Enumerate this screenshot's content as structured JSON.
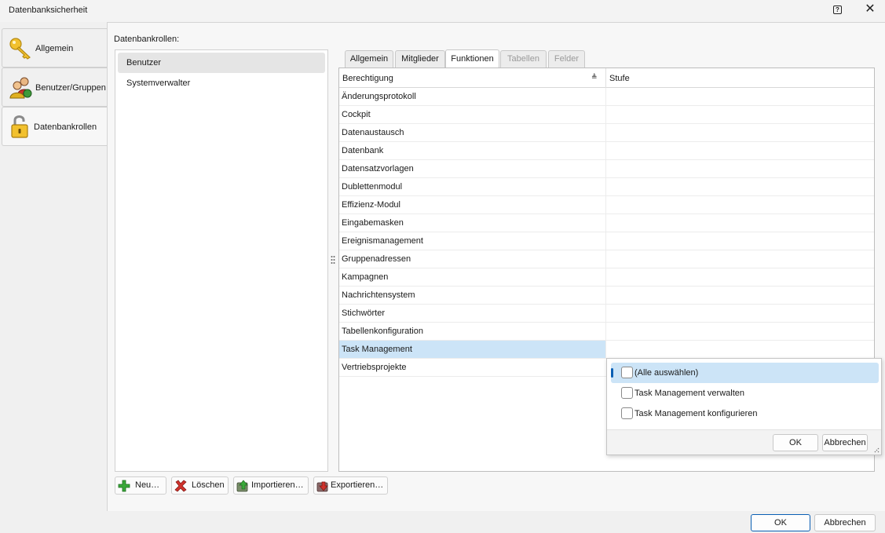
{
  "window": {
    "title": "Datenbanksicherheit",
    "help_glyph": "?",
    "close_glyph": "✕"
  },
  "nav": {
    "items": [
      {
        "label": "Allgemein",
        "icon": "key-icon"
      },
      {
        "label": "Benutzer/Gruppen",
        "icon": "users-icon"
      },
      {
        "label": "Datenbankrollen",
        "icon": "unlocked-padlock-icon",
        "active": true
      }
    ]
  },
  "roles": {
    "label": "Datenbankrollen:",
    "items": [
      "Benutzer",
      "Systemverwalter"
    ],
    "selected": "Benutzer"
  },
  "tabs": [
    {
      "label": "Allgemein",
      "state": "normal"
    },
    {
      "label": "Mitglieder",
      "state": "normal"
    },
    {
      "label": "Funktionen",
      "state": "active"
    },
    {
      "label": "Tabellen",
      "state": "disabled"
    },
    {
      "label": "Felder",
      "state": "disabled"
    }
  ],
  "grid": {
    "columns": [
      "Berechtigung",
      "Stufe"
    ],
    "sort_glyph": "≜",
    "rows": [
      "Änderungsprotokoll",
      "Cockpit",
      "Datenaustausch",
      "Datenbank",
      "Datensatzvorlagen",
      "Dublettenmodul",
      "Effizienz-Modul",
      "Eingabemasken",
      "Ereignismanagement",
      "Gruppenadressen",
      "Kampagnen",
      "Nachrichtensystem",
      "Stichwörter",
      "Tabellenkonfiguration",
      "Task Management",
      "Vertriebsprojekte"
    ],
    "selected_row": "Task Management"
  },
  "popup": {
    "options": [
      {
        "label": "(Alle auswählen)",
        "checked": false
      },
      {
        "label": "Task Management verwalten",
        "checked": false
      },
      {
        "label": "Task Management konfigurieren",
        "checked": false
      }
    ],
    "ok_label": "OK",
    "cancel_label": "Abbrechen"
  },
  "actions": {
    "new_label": "Neu…",
    "delete_label": "Löschen",
    "import_label": "Importieren…",
    "export_label": "Exportieren…"
  },
  "dialog": {
    "ok_label": "OK",
    "cancel_label": "Abbrechen"
  },
  "colors": {
    "selection": "#cce4f7",
    "accent": "#0a5fb4"
  }
}
